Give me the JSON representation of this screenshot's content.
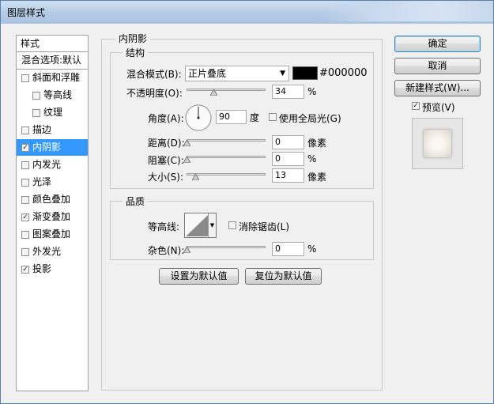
{
  "window": {
    "title": "图层样式"
  },
  "left_panel": {
    "title": "样式",
    "items": [
      {
        "label": "混合选项:默认",
        "has_checkbox": false,
        "checked": false,
        "indent": false
      },
      {
        "label": "斜面和浮雕",
        "has_checkbox": true,
        "checked": false,
        "indent": false
      },
      {
        "label": "等高线",
        "has_checkbox": true,
        "checked": false,
        "indent": true
      },
      {
        "label": "纹理",
        "has_checkbox": true,
        "checked": false,
        "indent": true
      },
      {
        "label": "描边",
        "has_checkbox": true,
        "checked": false,
        "indent": false
      },
      {
        "label": "内阴影",
        "has_checkbox": true,
        "checked": true,
        "indent": false,
        "selected": true
      },
      {
        "label": "内发光",
        "has_checkbox": true,
        "checked": false,
        "indent": false
      },
      {
        "label": "光泽",
        "has_checkbox": true,
        "checked": false,
        "indent": false
      },
      {
        "label": "颜色叠加",
        "has_checkbox": true,
        "checked": false,
        "indent": false
      },
      {
        "label": "渐变叠加",
        "has_checkbox": true,
        "checked": true,
        "indent": false
      },
      {
        "label": "图案叠加",
        "has_checkbox": true,
        "checked": false,
        "indent": false
      },
      {
        "label": "外发光",
        "has_checkbox": true,
        "checked": false,
        "indent": false
      },
      {
        "label": "投影",
        "has_checkbox": true,
        "checked": true,
        "indent": false
      }
    ]
  },
  "main": {
    "section_title": "内阴影",
    "structure": {
      "title": "结构",
      "blend_mode_label": "混合模式(B):",
      "blend_mode_value": "正片叠底",
      "color_hex": "#000000",
      "opacity_label": "不透明度(O):",
      "opacity_value": "34",
      "opacity_unit": "%",
      "angle_label": "角度(A):",
      "angle_value": "90",
      "angle_unit": "度",
      "global_light_label": "使用全局光(G)",
      "global_light_checked": false,
      "distance_label": "距离(D):",
      "distance_value": "0",
      "distance_unit": "像素",
      "choke_label": "阻塞(C):",
      "choke_value": "0",
      "choke_unit": "%",
      "size_label": "大小(S):",
      "size_value": "13",
      "size_unit": "像素"
    },
    "quality": {
      "title": "品质",
      "contour_label": "等高线:",
      "antialias_label": "消除锯齿(L)",
      "antialias_checked": false,
      "noise_label": "杂色(N):",
      "noise_value": "0",
      "noise_unit": "%"
    },
    "set_default_label": "设置为默认值",
    "reset_default_label": "复位为默认值"
  },
  "right_panel": {
    "ok_label": "确定",
    "cancel_label": "取消",
    "new_style_label": "新建样式(W)...",
    "preview_label": "预览(V)",
    "preview_checked": true
  },
  "colors": {
    "accent": "#3399ff",
    "swatch": "#000000"
  }
}
